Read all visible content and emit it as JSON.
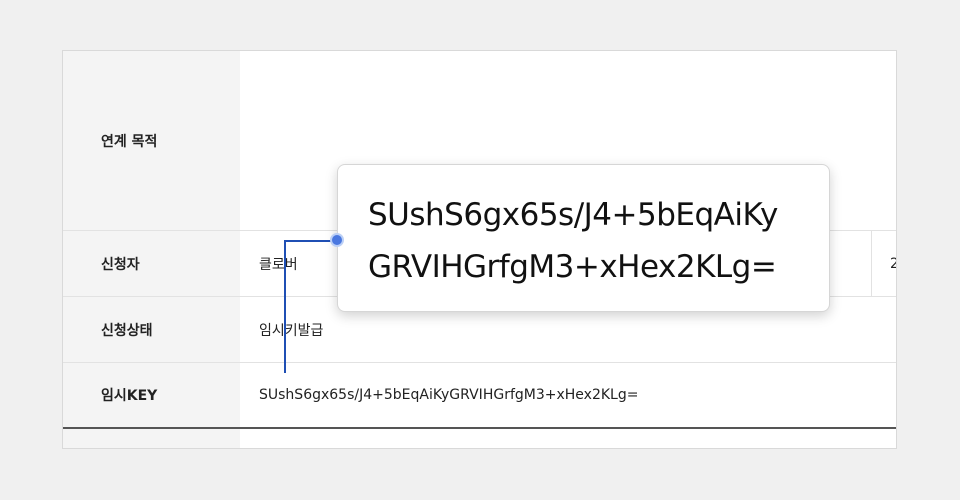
{
  "rows": [
    {
      "label": "연계 목적",
      "value": ""
    },
    {
      "label": "신청자",
      "value": "클로버",
      "extra": "2"
    },
    {
      "label": "신청상태",
      "value": "임시키발급"
    },
    {
      "label": "임시KEY",
      "value": "SUshS6gx65s/J4+5bEqAiKyGRVIHGrfgM3+xHex2KLg="
    }
  ],
  "popup": {
    "line1": "SUshS6gx65s/J4+5bEqAiKy",
    "line2": "GRVIHGrfgM3+xHex2KLg="
  },
  "colors": {
    "connector": "#1f4fb4",
    "dot": "#4a78e0"
  }
}
